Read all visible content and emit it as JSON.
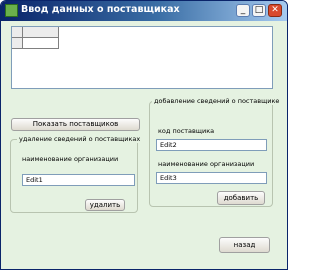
{
  "window": {
    "title": "Ввод данных о поставщиках",
    "min_label": "_",
    "max_label": "□",
    "close_label": "✕"
  },
  "buttons": {
    "show_suppliers": "Показать поставщиков",
    "delete": "удалить",
    "add": "добавить",
    "back": "назад"
  },
  "delete_panel": {
    "title": "удаление сведений о поставщиках",
    "org_name_label": "наименование организации",
    "edit1_value": "Edit1"
  },
  "add_panel": {
    "title": "добавление сведений о поставщике",
    "code_label": "код поставщика",
    "edit2_value": "Edit2",
    "org_name_label": "наименование организации",
    "edit3_value": "Edit3"
  },
  "colors": {
    "form_background": "#e5f2e1",
    "titlebar": "#0a246a",
    "close_button": "#d84a2e"
  },
  "icons": [
    "app-icon",
    "minimize-icon",
    "maximize-icon",
    "close-icon"
  ]
}
